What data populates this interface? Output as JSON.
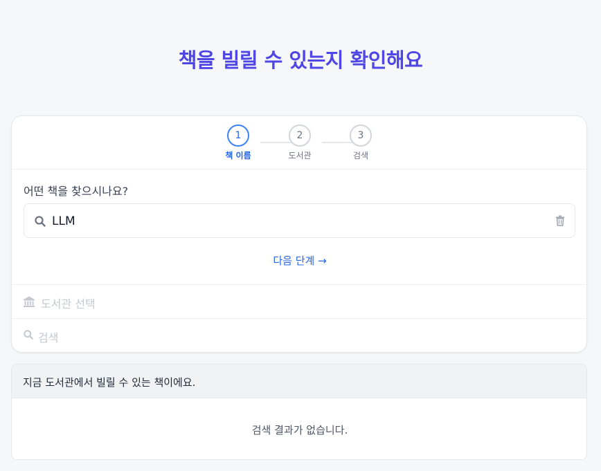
{
  "title": "책을 빌릴 수 있는지 확인해요",
  "stepper": {
    "steps": [
      {
        "number": "1",
        "label": "책 이름",
        "state": "active"
      },
      {
        "number": "2",
        "label": "도서관",
        "state": "inactive"
      },
      {
        "number": "3",
        "label": "검색",
        "state": "inactive"
      }
    ]
  },
  "book_step": {
    "question": "어떤 책을 찾으시나요?",
    "search_value": "LLM",
    "search_icon": "search-icon",
    "clear_icon": "trash-icon",
    "next_label": "다음 단계 →"
  },
  "collapsed_steps": {
    "library": {
      "label": "도서관 선택",
      "icon": "library-icon"
    },
    "search": {
      "label": "검색",
      "icon": "search-icon"
    }
  },
  "results": {
    "header": "지금 도서관에서 빌릴 수 있는 책이에요.",
    "empty_message": "검색 결과가 없습니다."
  },
  "colors": {
    "accent": "#4f46e5",
    "primary": "#2563eb",
    "active_step": "#3b82f6",
    "disabled_text": "#c4c8cf"
  }
}
